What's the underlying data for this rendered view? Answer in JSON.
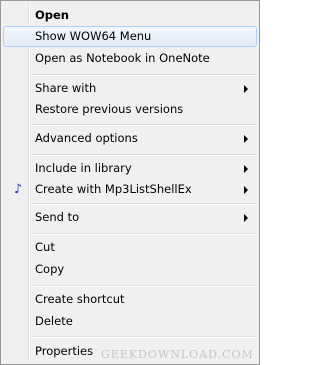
{
  "context_menu": {
    "items": [
      {
        "label": "Open",
        "bold": true
      },
      {
        "label": "Show WOW64 Menu",
        "highlighted": true
      },
      {
        "label": "Open as Notebook in OneNote"
      },
      {
        "label": "Share with",
        "submenu": true
      },
      {
        "label": "Restore previous versions"
      },
      {
        "label": "Advanced options",
        "submenu": true
      },
      {
        "label": "Include in library",
        "submenu": true
      },
      {
        "label": "Create with Mp3ListShellEx",
        "submenu": true,
        "icon": "music-note-icon"
      },
      {
        "label": "Send to",
        "submenu": true
      },
      {
        "label": "Cut"
      },
      {
        "label": "Copy"
      },
      {
        "label": "Create shortcut"
      },
      {
        "label": "Delete"
      },
      {
        "label": "Properties"
      }
    ],
    "icon_glyph": "♪"
  },
  "watermark": {
    "text": "GEEKDOWNLOAD.COM"
  },
  "colors": {
    "menu_background": "#f0f0f0",
    "menu_border": "#979797",
    "highlight_border": "#aecff7",
    "icon_accent": "#1a3fa8"
  }
}
